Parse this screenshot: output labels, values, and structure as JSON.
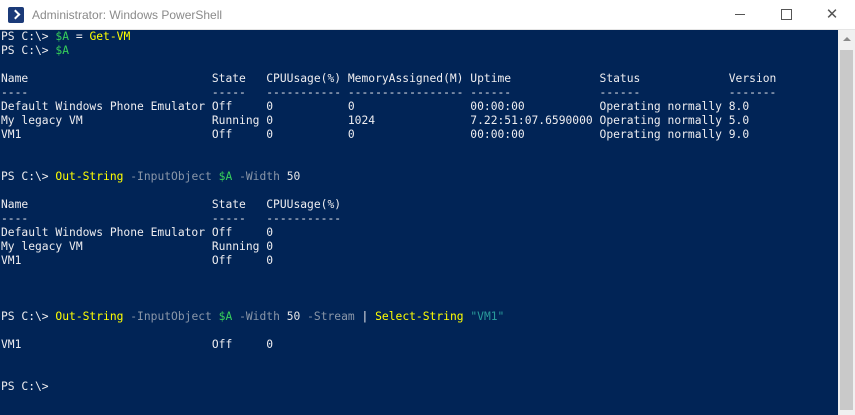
{
  "window": {
    "title": "Administrator: Windows PowerShell",
    "controls": {
      "minimize": "—",
      "maximize": "☐",
      "close": "✕"
    }
  },
  "colors": {
    "background": "#012456",
    "text": "#eeedf0",
    "command": "#ffff00",
    "variable": "#36d05a",
    "parameter": "#8a96a8",
    "string": "#2a9b9b"
  },
  "icons": {
    "app": "powershell-icon"
  },
  "console": {
    "prompt": "PS C:\\> ",
    "cmd1": {
      "var": "$A",
      "op": " = ",
      "command": "Get-VM"
    },
    "cmd2": {
      "var": "$A"
    },
    "table1": {
      "header": "Name                           State   CPUUsage(%) MemoryAssigned(M) Uptime             Status             Version",
      "sep": "----                           -----   ----------- ----------------- ------             ------             -------",
      "rows": [
        "Default Windows Phone Emulator Off     0           0                 00:00:00           Operating normally 8.0",
        "My legacy VM                   Running 0           1024              7.22:51:07.6590000 Operating normally 5.0",
        "VM1                            Off     0           0                 00:00:00           Operating normally 9.0"
      ]
    },
    "cmd3": {
      "command": "Out-String",
      "param1": " -InputObject ",
      "var": "$A",
      "param2": " -Width ",
      "num": "50"
    },
    "table2": {
      "header": "Name                           State   CPUUsage(%)",
      "sep": "----                           -----   -----------",
      "rows": [
        "Default Windows Phone Emulator Off     0",
        "My legacy VM                   Running 0",
        "VM1                            Off     0"
      ]
    },
    "cmd4": {
      "command": "Out-String",
      "param1": " -InputObject ",
      "var": "$A",
      "param2": " -Width ",
      "num": "50",
      "param3": " -Stream ",
      "pipe": "| ",
      "command2": "Select-String",
      "string": " \"VM1\""
    },
    "result": "VM1                            Off     0",
    "final_prompt": "PS C:\\>"
  }
}
